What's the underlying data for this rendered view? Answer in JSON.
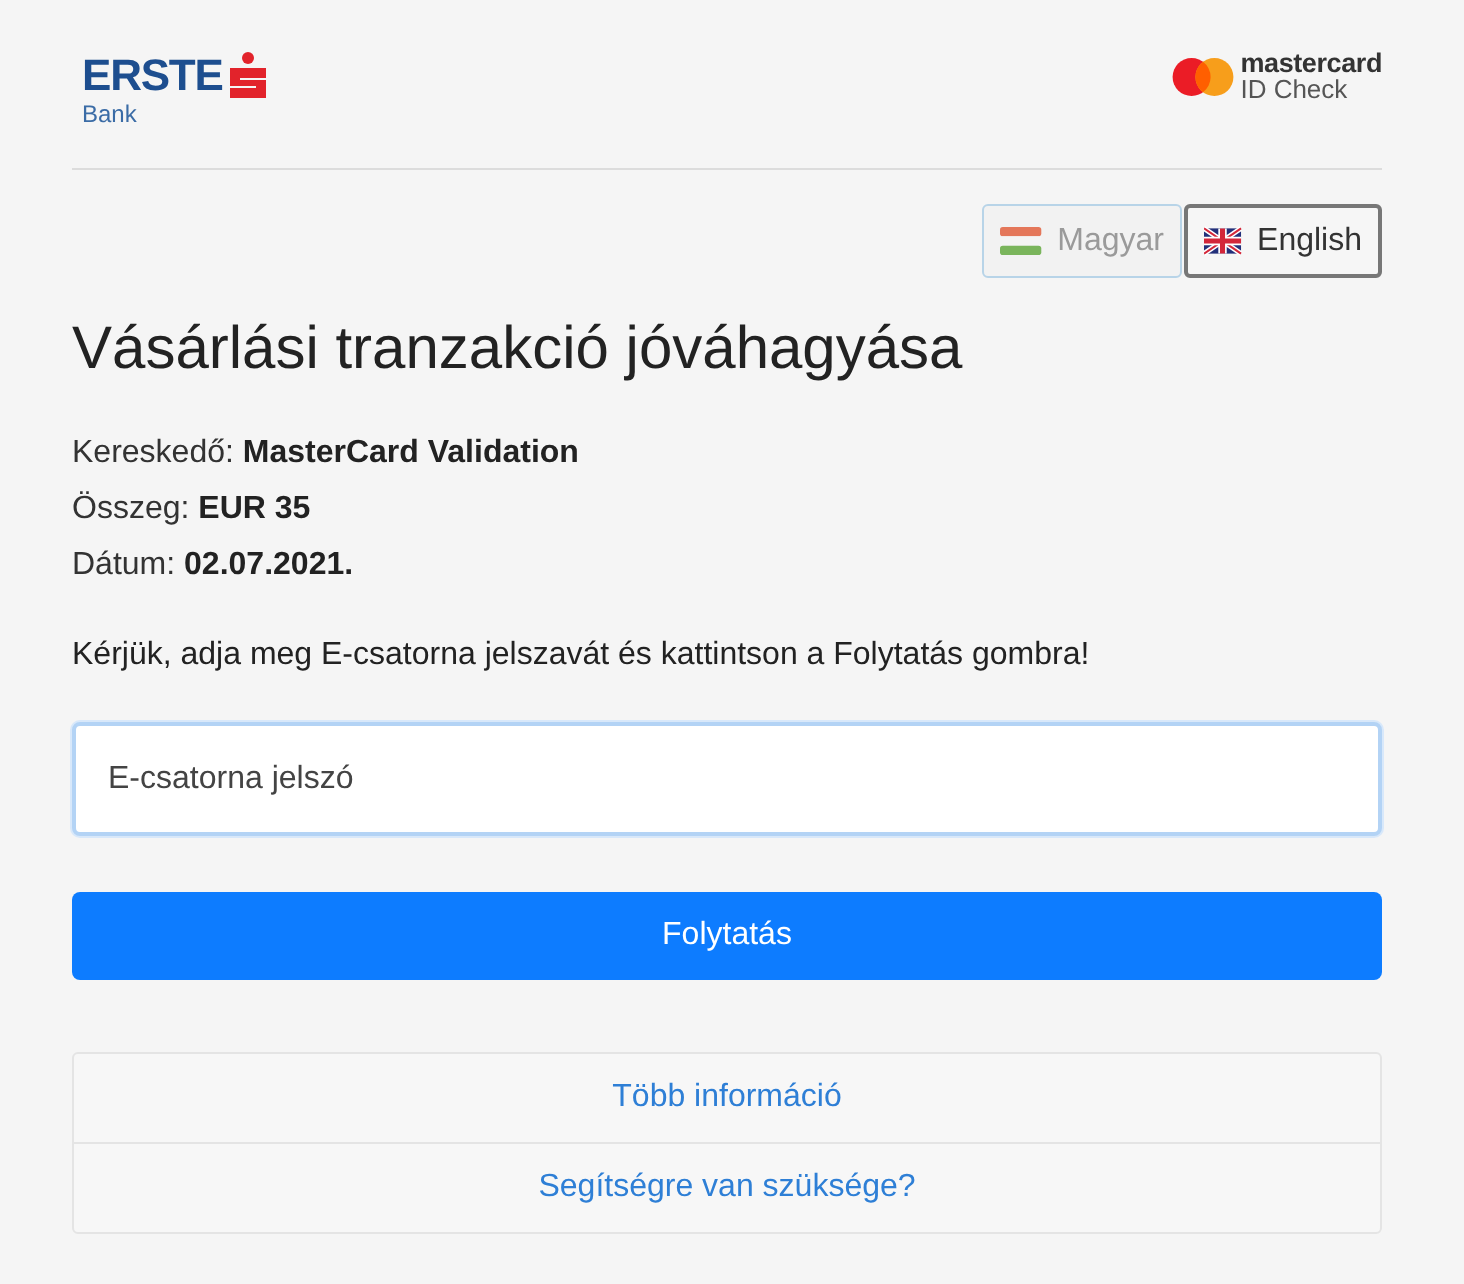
{
  "header": {
    "bank_logo": {
      "name": "ERSTE",
      "subtitle": "Bank"
    },
    "card_logo": {
      "name": "mastercard",
      "subtitle": "ID Check"
    }
  },
  "languages": [
    {
      "label": "Magyar",
      "kind": "hu",
      "selected": true
    },
    {
      "label": "English",
      "kind": "gb",
      "selected": false
    }
  ],
  "title": "Vásárlási tranzakció jóváhagyása",
  "details": [
    {
      "label": "Kereskedő:",
      "value": "MasterCard Validation"
    },
    {
      "label": "Összeg:",
      "value": "EUR 35"
    },
    {
      "label": "Dátum:",
      "value": "02.07.2021."
    }
  ],
  "instruction": "Kérjük, adja meg E-csatorna jelszavát és kattintson a Folytatás gombra!",
  "password_field": {
    "placeholder": "E-csatorna jelszó",
    "focused": true
  },
  "submit_button": "Folytatás",
  "links": [
    "Több információ",
    "Segítségre van szüksége?"
  ]
}
